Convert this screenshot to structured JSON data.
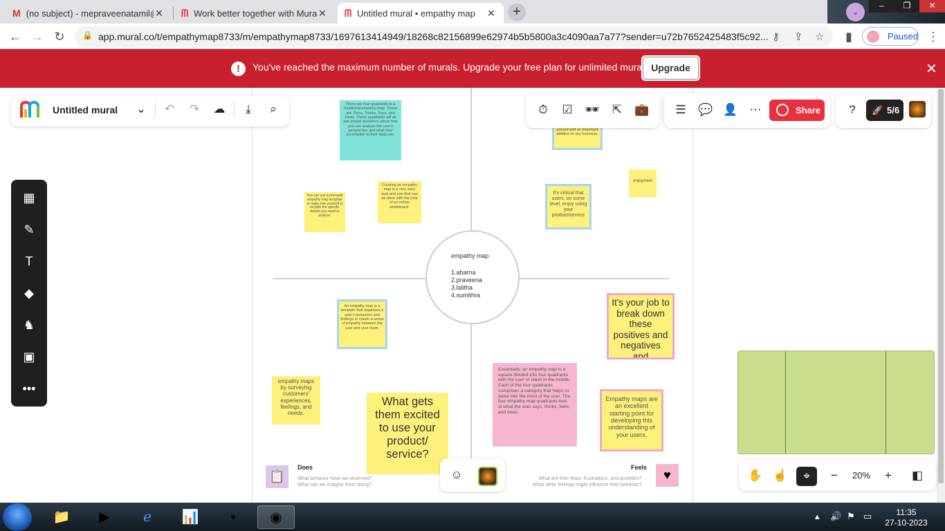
{
  "browser": {
    "tabs": [
      {
        "title": "(no subject) - mepraveenatamil@",
        "icon": "gmail-icon"
      },
      {
        "title": "Work better together with Mural",
        "icon": "mural-icon"
      },
      {
        "title": "Untitled mural • empathy map",
        "icon": "mural-icon",
        "active": true
      }
    ],
    "url": "app.mural.co/t/empathymap8733/m/empathymap8733/1697613414949/18268c82156899e62974b5b5800a3c4090aa7a77?sender=u72b7652425483f5c92...",
    "profile_status": "Paused"
  },
  "banner": {
    "message": "You've reached the maximum number of murals. Upgrade your free plan for unlimited murals.",
    "button": "Upgrade"
  },
  "header": {
    "title": "Untitled mural",
    "share_label": "Share",
    "collaborators": "5/6"
  },
  "center": {
    "title": "empathy map",
    "members": "1.abarna\n2.praveena\n3.lalitha\n4.sumithra"
  },
  "notes": {
    "teal_top": "There are four quadrants to a traditional empathy map. These are: Does, Thinks, Says, and Feels. These quadrants will all ask unique questions about how you can analyze the user's perspective and what they accomplish in their daily use.",
    "premade": "You can use a premade empathy map template or make one yourself to include the specific details you need to analyze.",
    "creating": "Creating an empathy map is a very easy task and one that can be done with the help of an online whiteboard.",
    "partial_top_right": "around and an important addition to any business.",
    "enjoyment": "enjoyment",
    "critical": "It's critical that users, on some level, enjoy using your product/service",
    "template": "An empathy map is a template that organizes a user's behaviors and feelings to create a sense of empathy between the user and your team.",
    "job": "It's your job to break down these positives and negatives and",
    "surveying": "empathy maps by surveying customers' experiences, feelings, and needs.",
    "excited": "What gets them excited to use your product/ service?",
    "essentially": "Essentially, an empathy map is a square divided into four quadrants with the user or client in the middle. Each of the four quadrants comprises a category that helps us delve into the mind of the user. The four empathy map quadrants look at what the user says, thinks, feels, and does.",
    "starting": "Empathy maps are an excellent starting point for developing this understanding of your users."
  },
  "quadrants": {
    "does": {
      "label": "Does",
      "sub": "What behavior have we observed?\nWhat can we imagine them doing?"
    },
    "feels": {
      "label": "Feels",
      "sub": "What are their fears, frustrations, and anxieties?\nWhat other feelings might influence their behavior?"
    }
  },
  "zoom": "20%",
  "taskbar": {
    "time": "11:35",
    "date": "27-10-2023"
  },
  "colors": {
    "banner": "#c8202f",
    "share": "#e8313e",
    "yellow_note": "#fdf07b",
    "teal_note": "#7fe3d8",
    "pink_note": "#f6b6d0",
    "minimap": "#c9dd8c"
  }
}
